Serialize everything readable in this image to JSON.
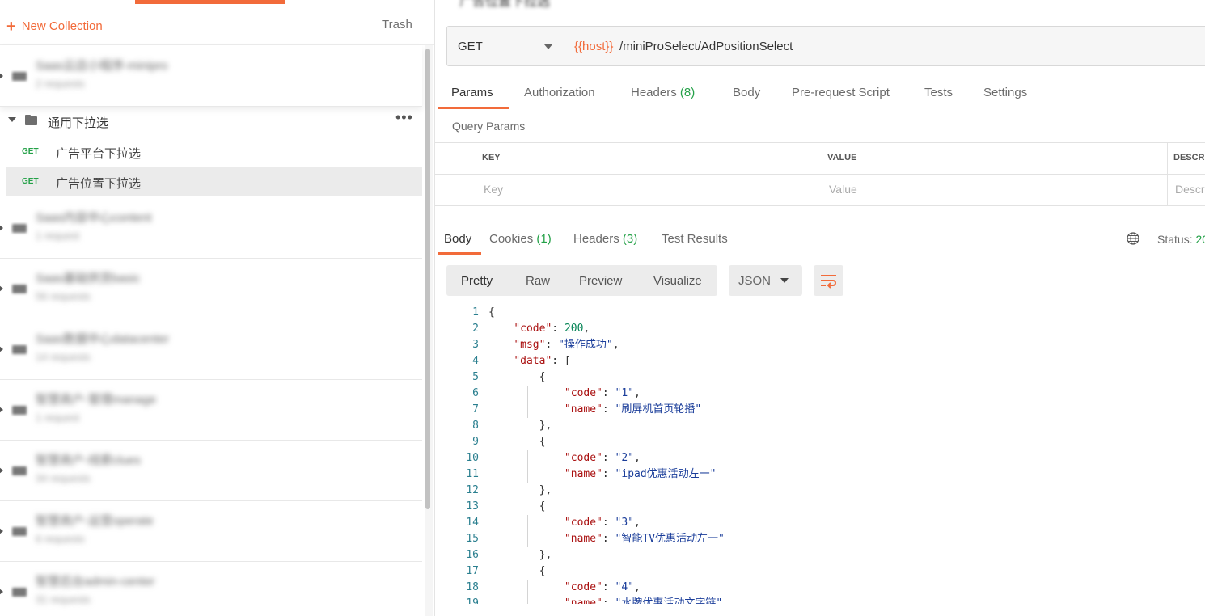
{
  "sidebar": {
    "new_collection": "New Collection",
    "trash": "Trash",
    "collections_before": [
      {
        "name": "Saas云店小程序-minipro",
        "count": "2 requests"
      }
    ],
    "folder": {
      "name": "通用下拉选",
      "requests": [
        {
          "method": "GET",
          "name": "广告平台下拉选"
        },
        {
          "method": "GET",
          "name": "广告位置下拉选"
        }
      ]
    },
    "collections_after": [
      {
        "name": "Saas内容中心content",
        "count": "1 request"
      },
      {
        "name": "Saas基础供货basic",
        "count": "56 requests"
      },
      {
        "name": "Saas数据中心datacenter",
        "count": "14 requests"
      },
      {
        "name": "智慧商户-管理manage",
        "count": "1 request"
      },
      {
        "name": "智慧商户-线索clues",
        "count": "34 requests"
      },
      {
        "name": "智慧商户-运营operate",
        "count": "6 requests"
      },
      {
        "name": "智慧后台admin-center",
        "count": "31 requests"
      }
    ]
  },
  "request": {
    "title": "广告位置下拉选",
    "method": "GET",
    "url_var": "{{host}}",
    "url_path": "/miniProSelect/AdPositionSelect",
    "tabs": [
      {
        "label": "Params",
        "count": ""
      },
      {
        "label": "Authorization",
        "count": ""
      },
      {
        "label": "Headers",
        "count": "(8)"
      },
      {
        "label": "Body",
        "count": ""
      },
      {
        "label": "Pre-request Script",
        "count": ""
      },
      {
        "label": "Tests",
        "count": ""
      },
      {
        "label": "Settings",
        "count": ""
      }
    ],
    "query_params_label": "Query Params",
    "columns": [
      "KEY",
      "VALUE",
      "DESCR"
    ],
    "placeholders": [
      "Key",
      "Value",
      "Descr"
    ]
  },
  "response": {
    "tabs": [
      {
        "label": "Body",
        "count": ""
      },
      {
        "label": "Cookies",
        "count": "(1)"
      },
      {
        "label": "Headers",
        "count": "(3)"
      },
      {
        "label": "Test Results",
        "count": ""
      }
    ],
    "status_label": "Status:",
    "status_value": "20",
    "view_modes": [
      "Pretty",
      "Raw",
      "Preview",
      "Visualize"
    ],
    "format": "JSON",
    "lines": [
      "{",
      "    \"code\": 200,",
      "    \"msg\": \"操作成功\",",
      "    \"data\": [",
      "        {",
      "            \"code\": \"1\",",
      "            \"name\": \"刷屏机首页轮播\"",
      "        },",
      "        {",
      "            \"code\": \"2\",",
      "            \"name\": \"ipad优惠活动左一\"",
      "        },",
      "        {",
      "            \"code\": \"3\",",
      "            \"name\": \"智能TV优惠活动左一\"",
      "        },",
      "        {",
      "            \"code\": \"4\",",
      "            \"name\": \"水牌优惠活动文字链\""
    ]
  },
  "colors": {
    "accent": "#f26b3a",
    "method_get": "#24a148",
    "count_green": "#24a148"
  }
}
